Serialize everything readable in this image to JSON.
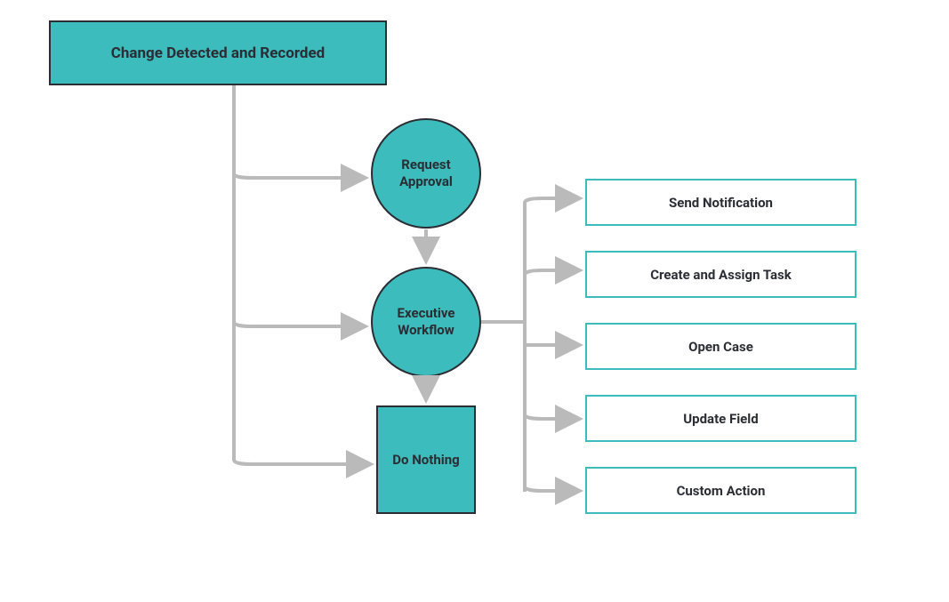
{
  "header": {
    "title": "Change Detected and Recorded"
  },
  "nodes": {
    "request_approval": "Request Approval",
    "executive_workflow": "Executive Workflow",
    "do_nothing": "Do Nothing"
  },
  "actions": [
    "Send Notification",
    "Create and Assign Task",
    "Open Case",
    "Update Field",
    "Custom Action"
  ],
  "colors": {
    "teal": "#3dbcbd",
    "dark": "#2a2e34",
    "arrow": "#bababa"
  },
  "chart_data": {
    "type": "flowchart",
    "title": "Change Detected and Recorded",
    "root": "Change Detected and Recorded",
    "branches": [
      {
        "label": "Request Approval",
        "shape": "circle",
        "next": "Executive Workflow"
      },
      {
        "label": "Executive Workflow",
        "shape": "circle",
        "outputs": [
          "Send Notification",
          "Create and Assign Task",
          "Open Case",
          "Update Field",
          "Custom Action"
        ],
        "next": "Do Nothing"
      },
      {
        "label": "Do Nothing",
        "shape": "rectangle"
      }
    ]
  }
}
